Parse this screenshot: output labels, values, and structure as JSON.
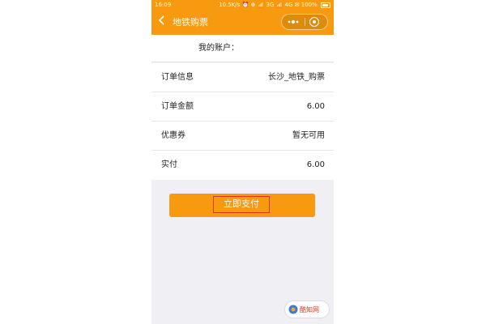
{
  "status_bar": {
    "time": "16:09",
    "network": "10.5K/s ⏰ ⊕ 📶 3G 📶 4G ✉",
    "battery": "100%"
  },
  "navbar": {
    "back_icon": "chevron-left-icon",
    "title": "地铁购票",
    "more_icon": "more-dots-icon",
    "close_icon": "target-circle-icon"
  },
  "account": {
    "label": "我的账户："
  },
  "order": {
    "rows": [
      {
        "key": "订单信息",
        "value": "长沙_地铁_购票"
      },
      {
        "key": "订单金额",
        "value": "6.00"
      },
      {
        "key": "优惠券",
        "value": "暂无可用"
      },
      {
        "key": "实付",
        "value": "6.00"
      }
    ]
  },
  "pay": {
    "label": "立即支付"
  },
  "watermark": {
    "logo_icon": "site-logo-icon",
    "text": "酷知网"
  },
  "colors": {
    "brand_orange": "#f79a0f",
    "highlight_red": "#d9361c",
    "page_bg": "#efeff4"
  }
}
